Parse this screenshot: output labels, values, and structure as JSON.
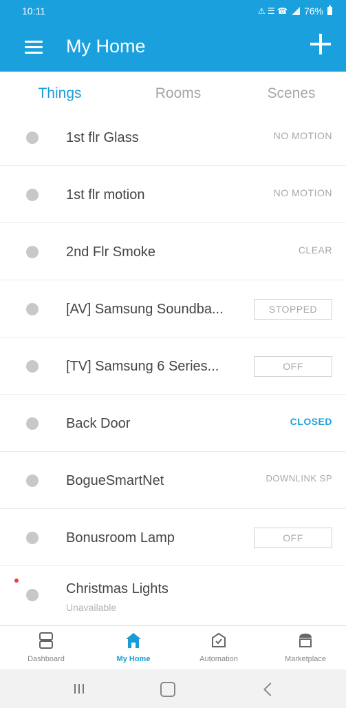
{
  "status_bar": {
    "time": "10:11",
    "system_icons": "⚠ ☰ ☎",
    "battery": "76%"
  },
  "app_bar": {
    "title": "My Home",
    "add_icon": "plus-icon"
  },
  "tabs": [
    {
      "label": "Things",
      "active": true
    },
    {
      "label": "Rooms",
      "active": false
    },
    {
      "label": "Scenes",
      "active": false
    }
  ],
  "devices": [
    {
      "name": "1st flr Glass",
      "status": "NO MOTION",
      "style": "plain"
    },
    {
      "name": "1st flr motion",
      "status": "NO MOTION",
      "style": "plain"
    },
    {
      "name": "2nd Flr Smoke",
      "status": "CLEAR",
      "style": "plain"
    },
    {
      "name": "[AV] Samsung Soundba...",
      "status": "STOPPED",
      "style": "boxed"
    },
    {
      "name": "[TV] Samsung 6 Series...",
      "status": "OFF",
      "style": "boxed"
    },
    {
      "name": "Back Door",
      "status": "CLOSED",
      "style": "blue"
    },
    {
      "name": "BogueSmartNet",
      "status": "DOWNLINK SP",
      "style": "plain"
    },
    {
      "name": "Bonusroom Lamp",
      "status": "OFF",
      "style": "boxed"
    },
    {
      "name": "Christmas Lights",
      "sub": "Unavailable",
      "style": "none"
    }
  ],
  "bottom_nav": [
    {
      "label": "Dashboard",
      "icon": "dashboard-icon"
    },
    {
      "label": "My Home",
      "icon": "home-icon",
      "active": true
    },
    {
      "label": "Automation",
      "icon": "automation-icon"
    },
    {
      "label": "Marketplace",
      "icon": "marketplace-icon"
    }
  ],
  "colors": {
    "primary": "#1aa0dd",
    "active_blue": "#1a9bd7",
    "muted": "#a6a6a6",
    "alert_red": "#e4423f"
  }
}
